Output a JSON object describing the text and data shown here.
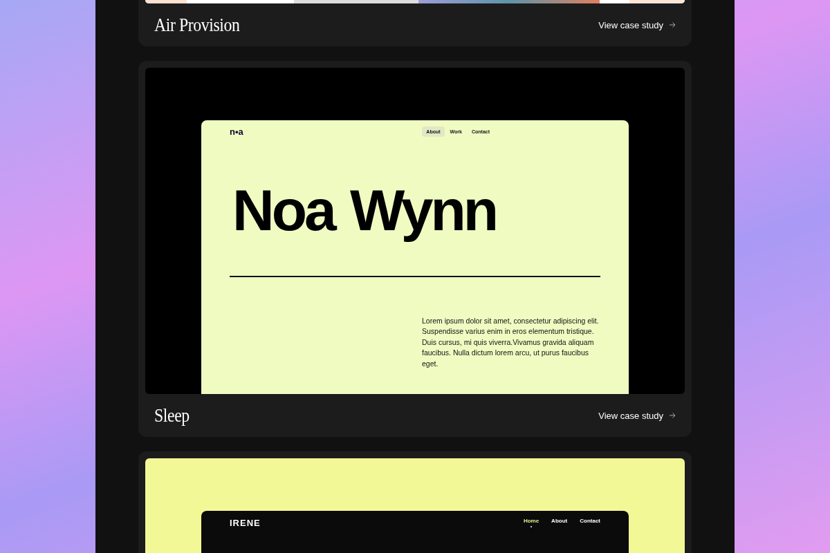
{
  "projects": [
    {
      "kind": "picture",
      "title": "Air Provision",
      "link": "View case study"
    },
    {
      "kind": "noa",
      "title": "Sleep",
      "link": "View case study",
      "site": {
        "logo": "n•a",
        "nav": [
          {
            "label": "About",
            "selected": true
          },
          {
            "label": "Work",
            "selected": false
          },
          {
            "label": "Contact",
            "selected": false
          }
        ],
        "heading": "Noa Wynn",
        "body": "Lorem ipsum dolor sit amet, consectetur adipiscing elit. Suspendisse varius enim in eros elementum tristique. Duis cursus, mi quis viverra.Vivamus gravida aliquam faucibus. Nulla dictum lorem arcu, ut purus faucibus eget."
      }
    },
    {
      "kind": "irene",
      "site": {
        "logo": "IRENE",
        "nav": [
          {
            "label": "Home",
            "selected": true
          },
          {
            "label": "About",
            "selected": false
          },
          {
            "label": "Contact",
            "selected": false
          }
        ]
      }
    }
  ]
}
